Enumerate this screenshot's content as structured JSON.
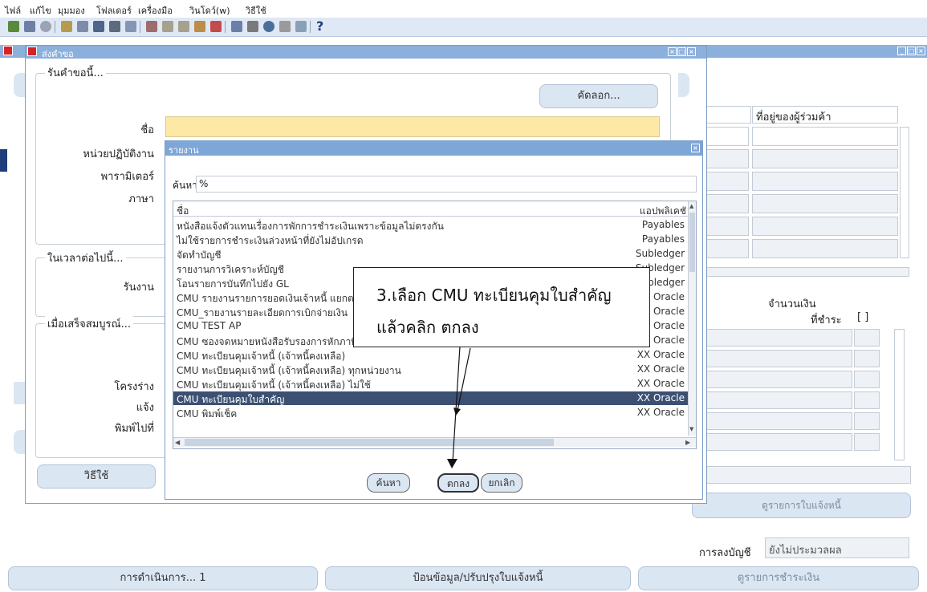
{
  "menu": [
    "ไฟล์",
    "แก้ไข",
    "มุมมอง",
    "โฟลเดอร์",
    "เครื่องมือ",
    "วินโดว์(w)",
    "วิธีใช้"
  ],
  "toolbar": {
    "help_glyph": "?"
  },
  "back_window": {
    "col_header_supplier_address": "ที่อยู่ของผู้ร่วมค้า",
    "amount_label": "จำนวนเงิน",
    "due_label": "ที่ชำระ",
    "due_bracket": "[ ]",
    "view_invoice_lines": "ดูรายการใบแจ้งหนี้",
    "posting_label": "การลงบัญชี",
    "posting_value": "ยังไม่ประมวลผล",
    "actions_button": "การดำเนินการ... 1",
    "enter_invoice_button": "ป้อนข้อมูล/ปรับปรุงใบแจ้งหนี้",
    "view_payments_button": "ดูรายการชำระเงิน"
  },
  "request_window": {
    "title": "ส่งคำขอ",
    "group_run_request": "รันคำขอนี้...",
    "copy_button": "คัดลอก...",
    "name_label": "ชื่อ",
    "ou_label": "หน่วยปฏิบัติงาน",
    "params_label": "พารามิเตอร์",
    "lang_label": "ภาษา",
    "group_at_time": "ในเวลาต่อไปนี้...",
    "run_label": "รันงาน",
    "group_upon_completion": "เมื่อเสร็จสมบูรณ์...",
    "layout_label": "โครงร่าง",
    "notify_label": "แจ้ง",
    "print_to_label": "พิมพ์ไปที่",
    "help_button": "วิธีใช้"
  },
  "dialog": {
    "title": "รายงาน",
    "find_label": "ค้นหา",
    "find_value": "%",
    "col_name": "ชื่อ",
    "col_app": "แอปพลิเคชั",
    "rows": [
      {
        "name": "หนังสือแจ้งตัวแทนเรื่องการพักการชำระเงินเพราะข้อมูลไม่ตรงกัน",
        "app": "Payables",
        "selected": false
      },
      {
        "name": "ไม่ใช้รายการชำระเงินล่วงหน้าที่ยังไม่อัปเกรด",
        "app": "Payables",
        "selected": false
      },
      {
        "name": "จัดทำบัญชี",
        "app": "Subledger",
        "selected": false
      },
      {
        "name": "รายงานการวิเคราะห์บัญชี",
        "app": "Subledger",
        "selected": false
      },
      {
        "name": "โอนรายการบันทึกไปยัง GL",
        "app": "Subledger",
        "selected": false
      },
      {
        "name": "CMU รายงานรายการยอดเงินเจ้าหนี้ แยกตามเจ้าหนี้",
        "app": "XX Oracle",
        "selected": false
      },
      {
        "name": "CMU_รายงานรายละเอียดการเบิกจ่ายเงิน",
        "app": "XX Oracle",
        "selected": false
      },
      {
        "name": "CMU TEST AP",
        "app": "XX Oracle",
        "selected": false
      },
      {
        "name": "CMU ซองจดหมายหนังสือรับรองการหักภาษี ณ ที่จ่าย",
        "app": "XX Oracle",
        "selected": false
      },
      {
        "name": "CMU ทะเบียนคุมเจ้าหนี้ (เจ้าหนี้คงเหลือ)",
        "app": "XX Oracle",
        "selected": false
      },
      {
        "name": "CMU ทะเบียนคุมเจ้าหนี้ (เจ้าหนี้คงเหลือ) ทุกหน่วยงาน",
        "app": "XX Oracle",
        "selected": false
      },
      {
        "name": "CMU ทะเบียนคุมเจ้าหนี้ (เจ้าหนี้คงเหลือ) ไม่ใช้",
        "app": "XX Oracle",
        "selected": false
      },
      {
        "name": "CMU ทะเบียนคุมใบสำคัญ",
        "app": "XX Oracle",
        "selected": true
      },
      {
        "name": "CMU พิมพ์เช็ค",
        "app": "XX Oracle",
        "selected": false
      }
    ],
    "find_button": "ค้นหา",
    "ok_button": "ตกลง",
    "cancel_button": "ยกเลิก"
  },
  "callout": {
    "line1": "3.เลือก CMU ทะเบียนคุมใบสำคัญ",
    "line2": "แล้วคลิก ตกลง"
  },
  "colors": {
    "selection": "#3c5073",
    "required_field": "#fde8a6",
    "titlebar": "#8cb0dc",
    "button": "#dbe6f3"
  }
}
